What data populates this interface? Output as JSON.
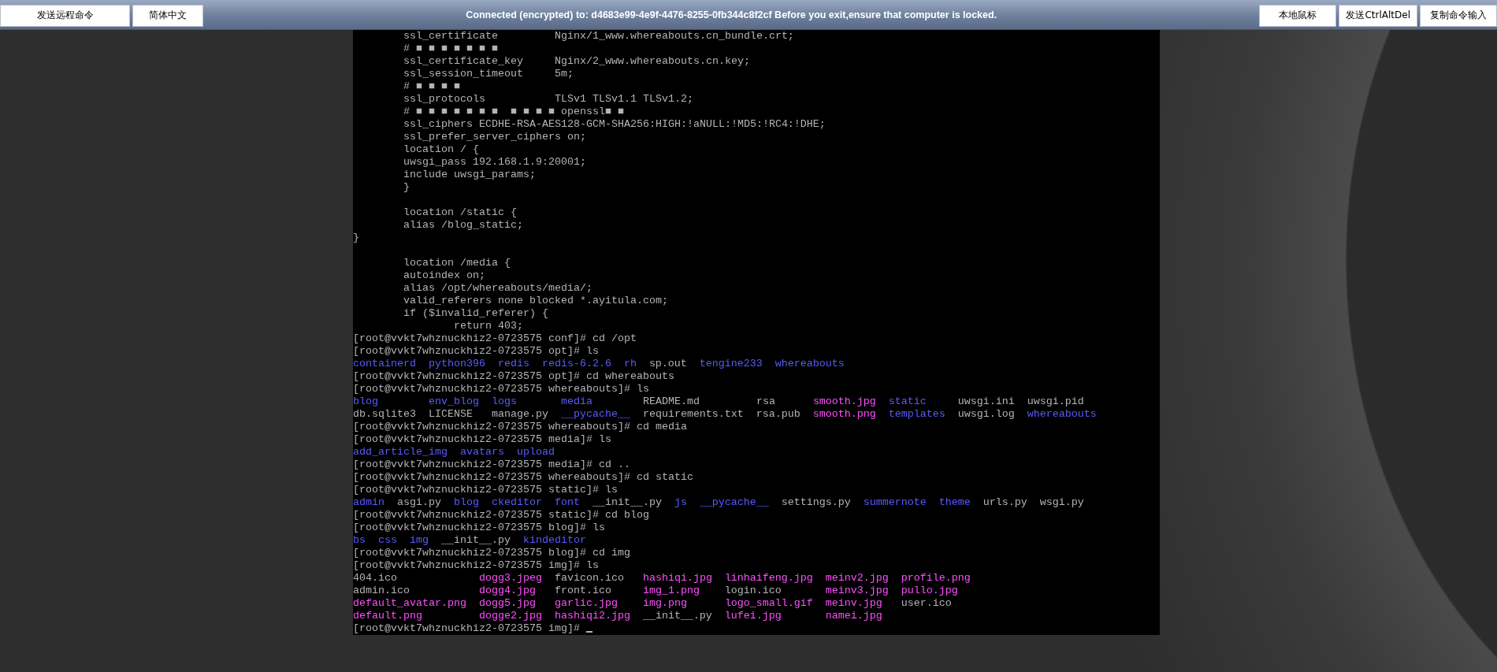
{
  "toolbar": {
    "left_buttons": [
      "发送远程命令",
      "简体中文"
    ],
    "status": "Connected (encrypted) to: d4683e99-4e9f-4476-8255-0fb344c8f2cf Before you exit,ensure that computer is locked.",
    "right_buttons": [
      "本地鼠标",
      "发送CtrlAltDel",
      "复制命令输入"
    ]
  },
  "terminal": {
    "cursor": true,
    "lines": [
      {
        "kind": "text",
        "text": "        ssl_certificate         Nginx/1_www.whereabouts.cn_bundle.crt;"
      },
      {
        "kind": "text",
        "text": "        # ■ ■ ■ ■ ■ ■ ■"
      },
      {
        "kind": "text",
        "text": "        ssl_certificate_key     Nginx/2_www.whereabouts.cn.key;"
      },
      {
        "kind": "text",
        "text": "        ssl_session_timeout     5m;"
      },
      {
        "kind": "text",
        "text": "        # ■ ■ ■ ■"
      },
      {
        "kind": "text",
        "text": "        ssl_protocols           TLSv1 TLSv1.1 TLSv1.2;"
      },
      {
        "kind": "text",
        "text": "        # ■ ■ ■ ■ ■ ■ ■  ■ ■ ■ ■ openssl■ ■"
      },
      {
        "kind": "text",
        "text": "        ssl_ciphers ECDHE-RSA-AES128-GCM-SHA256:HIGH:!aNULL:!MD5:!RC4:!DHE;"
      },
      {
        "kind": "text",
        "text": "        ssl_prefer_server_ciphers on;"
      },
      {
        "kind": "text",
        "text": "        location / {"
      },
      {
        "kind": "text",
        "text": "        uwsgi_pass 192.168.1.9:20001;"
      },
      {
        "kind": "text",
        "text": "        include uwsgi_params;"
      },
      {
        "kind": "text",
        "text": "        }"
      },
      {
        "kind": "blank"
      },
      {
        "kind": "text",
        "text": "        location /static {"
      },
      {
        "kind": "text",
        "text": "        alias /blog_static;"
      },
      {
        "kind": "text",
        "text": "}"
      },
      {
        "kind": "blank"
      },
      {
        "kind": "text",
        "text": "        location /media {"
      },
      {
        "kind": "text",
        "text": "        autoindex on;"
      },
      {
        "kind": "text",
        "text": "        alias /opt/whereabouts/media/;"
      },
      {
        "kind": "text",
        "text": "        valid_referers none blocked *.ayitula.com;"
      },
      {
        "kind": "text",
        "text": "        if ($invalid_referer) {"
      },
      {
        "kind": "text",
        "text": "                return 403;"
      },
      {
        "kind": "text",
        "text": "[root@vvkt7whznuckhiz2-0723575 conf]# cd /opt"
      },
      {
        "kind": "text",
        "text": "[root@vvkt7whznuckhiz2-0723575 opt]# ls"
      },
      {
        "kind": "listing",
        "rows": [
          [
            {
              "name": "containerd",
              "kind": "directory"
            },
            {
              "name": "python396",
              "kind": "directory"
            },
            {
              "name": "redis",
              "kind": "directory"
            },
            {
              "name": "redis-6.2.6",
              "kind": "directory"
            },
            {
              "name": "rh",
              "kind": "directory"
            },
            {
              "name": "sp.out",
              "kind": "file"
            },
            {
              "name": "tengine233",
              "kind": "directory"
            },
            {
              "name": "whereabouts",
              "kind": "directory"
            }
          ]
        ]
      },
      {
        "kind": "text",
        "text": "[root@vvkt7whznuckhiz2-0723575 opt]# cd whereabouts"
      },
      {
        "kind": "text",
        "text": "[root@vvkt7whznuckhiz2-0723575 whereabouts]# ls"
      },
      {
        "kind": "listing",
        "rows": [
          [
            {
              "name": "blog",
              "kind": "directory"
            },
            {
              "name": "env_blog",
              "kind": "directory"
            },
            {
              "name": "logs",
              "kind": "directory"
            },
            {
              "name": "media",
              "kind": "directory"
            },
            {
              "name": "README.md",
              "kind": "file"
            },
            {
              "name": "rsa",
              "kind": "file"
            },
            {
              "name": "smooth.jpg",
              "kind": "image"
            },
            {
              "name": "static",
              "kind": "directory"
            },
            {
              "name": "uwsgi.ini",
              "kind": "file"
            },
            {
              "name": "uwsgi.pid",
              "kind": "file"
            }
          ],
          [
            {
              "name": "db.sqlite3",
              "kind": "file"
            },
            {
              "name": "LICENSE",
              "kind": "file"
            },
            {
              "name": "manage.py",
              "kind": "file"
            },
            {
              "name": "__pycache__",
              "kind": "directory"
            },
            {
              "name": "requirements.txt",
              "kind": "file"
            },
            {
              "name": "rsa.pub",
              "kind": "file"
            },
            {
              "name": "smooth.png",
              "kind": "image"
            },
            {
              "name": "templates",
              "kind": "directory"
            },
            {
              "name": "uwsgi.log",
              "kind": "file"
            },
            {
              "name": "whereabouts",
              "kind": "directory"
            }
          ]
        ]
      },
      {
        "kind": "text",
        "text": "[root@vvkt7whznuckhiz2-0723575 whereabouts]# cd media"
      },
      {
        "kind": "text",
        "text": "[root@vvkt7whznuckhiz2-0723575 media]# ls"
      },
      {
        "kind": "listing",
        "rows": [
          [
            {
              "name": "add_article_img",
              "kind": "directory"
            },
            {
              "name": "avatars",
              "kind": "directory"
            },
            {
              "name": "upload",
              "kind": "directory"
            }
          ]
        ]
      },
      {
        "kind": "text",
        "text": "[root@vvkt7whznuckhiz2-0723575 media]# cd .."
      },
      {
        "kind": "text",
        "text": "[root@vvkt7whznuckhiz2-0723575 whereabouts]# cd static"
      },
      {
        "kind": "text",
        "text": "[root@vvkt7whznuckhiz2-0723575 static]# ls"
      },
      {
        "kind": "listing",
        "rows": [
          [
            {
              "name": "admin",
              "kind": "directory"
            },
            {
              "name": "asgi.py",
              "kind": "file"
            },
            {
              "name": "blog",
              "kind": "directory"
            },
            {
              "name": "ckeditor",
              "kind": "directory"
            },
            {
              "name": "font",
              "kind": "directory"
            },
            {
              "name": "__init__.py",
              "kind": "file"
            },
            {
              "name": "js",
              "kind": "directory"
            },
            {
              "name": "__pycache__",
              "kind": "directory"
            },
            {
              "name": "settings.py",
              "kind": "file"
            },
            {
              "name": "summernote",
              "kind": "directory"
            },
            {
              "name": "theme",
              "kind": "directory"
            },
            {
              "name": "urls.py",
              "kind": "file"
            },
            {
              "name": "wsgi.py",
              "kind": "file"
            }
          ]
        ]
      },
      {
        "kind": "text",
        "text": "[root@vvkt7whznuckhiz2-0723575 static]# cd blog"
      },
      {
        "kind": "text",
        "text": "[root@vvkt7whznuckhiz2-0723575 blog]# ls"
      },
      {
        "kind": "listing",
        "rows": [
          [
            {
              "name": "bs",
              "kind": "directory"
            },
            {
              "name": "css",
              "kind": "directory"
            },
            {
              "name": "img",
              "kind": "directory"
            },
            {
              "name": "__init__.py",
              "kind": "file"
            },
            {
              "name": "kindeditor",
              "kind": "directory"
            }
          ]
        ]
      },
      {
        "kind": "text",
        "text": "[root@vvkt7whznuckhiz2-0723575 blog]# cd img"
      },
      {
        "kind": "text",
        "text": "[root@vvkt7whznuckhiz2-0723575 img]# ls"
      },
      {
        "kind": "listing",
        "rows": [
          [
            {
              "name": "404.ico",
              "kind": "file"
            },
            {
              "name": "dogg3.jpeg",
              "kind": "image"
            },
            {
              "name": "favicon.ico",
              "kind": "file"
            },
            {
              "name": "hashiqi.jpg",
              "kind": "image"
            },
            {
              "name": "linhaifeng.jpg",
              "kind": "image"
            },
            {
              "name": "meinv2.jpg",
              "kind": "image"
            },
            {
              "name": "profile.png",
              "kind": "image"
            }
          ],
          [
            {
              "name": "admin.ico",
              "kind": "file"
            },
            {
              "name": "dogg4.jpg",
              "kind": "image"
            },
            {
              "name": "front.ico",
              "kind": "file"
            },
            {
              "name": "img_1.png",
              "kind": "image"
            },
            {
              "name": "login.ico",
              "kind": "file"
            },
            {
              "name": "meinv3.jpg",
              "kind": "image"
            },
            {
              "name": "pullo.jpg",
              "kind": "image"
            }
          ],
          [
            {
              "name": "default_avatar.png",
              "kind": "image"
            },
            {
              "name": "dogg5.jpg",
              "kind": "image"
            },
            {
              "name": "garlic.jpg",
              "kind": "image"
            },
            {
              "name": "img.png",
              "kind": "image"
            },
            {
              "name": "logo_small.gif",
              "kind": "image"
            },
            {
              "name": "meinv.jpg",
              "kind": "image"
            },
            {
              "name": "user.ico",
              "kind": "file"
            }
          ],
          [
            {
              "name": "default.png",
              "kind": "image"
            },
            {
              "name": "dogge2.jpg",
              "kind": "image"
            },
            {
              "name": "hashiqi2.jpg",
              "kind": "image"
            },
            {
              "name": "__init__.py",
              "kind": "file"
            },
            {
              "name": "lufei.jpg",
              "kind": "image"
            },
            {
              "name": "namei.jpg",
              "kind": "image"
            }
          ]
        ]
      },
      {
        "kind": "text",
        "text": "[root@vvkt7whznuckhiz2-0723575 img]#"
      }
    ]
  }
}
